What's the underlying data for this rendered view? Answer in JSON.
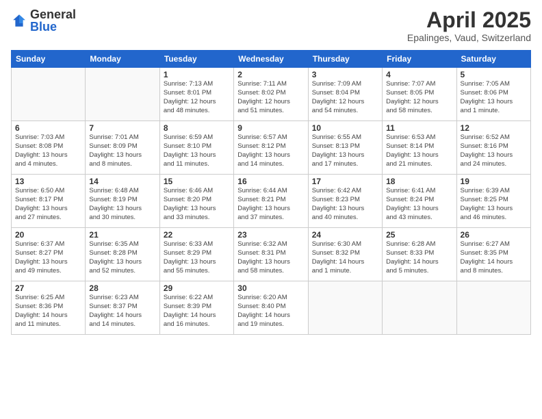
{
  "header": {
    "logo_general": "General",
    "logo_blue": "Blue",
    "month_title": "April 2025",
    "location": "Epalinges, Vaud, Switzerland"
  },
  "days_of_week": [
    "Sunday",
    "Monday",
    "Tuesday",
    "Wednesday",
    "Thursday",
    "Friday",
    "Saturday"
  ],
  "weeks": [
    [
      {
        "day": "",
        "info": ""
      },
      {
        "day": "",
        "info": ""
      },
      {
        "day": "1",
        "info": "Sunrise: 7:13 AM\nSunset: 8:01 PM\nDaylight: 12 hours\nand 48 minutes."
      },
      {
        "day": "2",
        "info": "Sunrise: 7:11 AM\nSunset: 8:02 PM\nDaylight: 12 hours\nand 51 minutes."
      },
      {
        "day": "3",
        "info": "Sunrise: 7:09 AM\nSunset: 8:04 PM\nDaylight: 12 hours\nand 54 minutes."
      },
      {
        "day": "4",
        "info": "Sunrise: 7:07 AM\nSunset: 8:05 PM\nDaylight: 12 hours\nand 58 minutes."
      },
      {
        "day": "5",
        "info": "Sunrise: 7:05 AM\nSunset: 8:06 PM\nDaylight: 13 hours\nand 1 minute."
      }
    ],
    [
      {
        "day": "6",
        "info": "Sunrise: 7:03 AM\nSunset: 8:08 PM\nDaylight: 13 hours\nand 4 minutes."
      },
      {
        "day": "7",
        "info": "Sunrise: 7:01 AM\nSunset: 8:09 PM\nDaylight: 13 hours\nand 8 minutes."
      },
      {
        "day": "8",
        "info": "Sunrise: 6:59 AM\nSunset: 8:10 PM\nDaylight: 13 hours\nand 11 minutes."
      },
      {
        "day": "9",
        "info": "Sunrise: 6:57 AM\nSunset: 8:12 PM\nDaylight: 13 hours\nand 14 minutes."
      },
      {
        "day": "10",
        "info": "Sunrise: 6:55 AM\nSunset: 8:13 PM\nDaylight: 13 hours\nand 17 minutes."
      },
      {
        "day": "11",
        "info": "Sunrise: 6:53 AM\nSunset: 8:14 PM\nDaylight: 13 hours\nand 21 minutes."
      },
      {
        "day": "12",
        "info": "Sunrise: 6:52 AM\nSunset: 8:16 PM\nDaylight: 13 hours\nand 24 minutes."
      }
    ],
    [
      {
        "day": "13",
        "info": "Sunrise: 6:50 AM\nSunset: 8:17 PM\nDaylight: 13 hours\nand 27 minutes."
      },
      {
        "day": "14",
        "info": "Sunrise: 6:48 AM\nSunset: 8:19 PM\nDaylight: 13 hours\nand 30 minutes."
      },
      {
        "day": "15",
        "info": "Sunrise: 6:46 AM\nSunset: 8:20 PM\nDaylight: 13 hours\nand 33 minutes."
      },
      {
        "day": "16",
        "info": "Sunrise: 6:44 AM\nSunset: 8:21 PM\nDaylight: 13 hours\nand 37 minutes."
      },
      {
        "day": "17",
        "info": "Sunrise: 6:42 AM\nSunset: 8:23 PM\nDaylight: 13 hours\nand 40 minutes."
      },
      {
        "day": "18",
        "info": "Sunrise: 6:41 AM\nSunset: 8:24 PM\nDaylight: 13 hours\nand 43 minutes."
      },
      {
        "day": "19",
        "info": "Sunrise: 6:39 AM\nSunset: 8:25 PM\nDaylight: 13 hours\nand 46 minutes."
      }
    ],
    [
      {
        "day": "20",
        "info": "Sunrise: 6:37 AM\nSunset: 8:27 PM\nDaylight: 13 hours\nand 49 minutes."
      },
      {
        "day": "21",
        "info": "Sunrise: 6:35 AM\nSunset: 8:28 PM\nDaylight: 13 hours\nand 52 minutes."
      },
      {
        "day": "22",
        "info": "Sunrise: 6:33 AM\nSunset: 8:29 PM\nDaylight: 13 hours\nand 55 minutes."
      },
      {
        "day": "23",
        "info": "Sunrise: 6:32 AM\nSunset: 8:31 PM\nDaylight: 13 hours\nand 58 minutes."
      },
      {
        "day": "24",
        "info": "Sunrise: 6:30 AM\nSunset: 8:32 PM\nDaylight: 14 hours\nand 1 minute."
      },
      {
        "day": "25",
        "info": "Sunrise: 6:28 AM\nSunset: 8:33 PM\nDaylight: 14 hours\nand 5 minutes."
      },
      {
        "day": "26",
        "info": "Sunrise: 6:27 AM\nSunset: 8:35 PM\nDaylight: 14 hours\nand 8 minutes."
      }
    ],
    [
      {
        "day": "27",
        "info": "Sunrise: 6:25 AM\nSunset: 8:36 PM\nDaylight: 14 hours\nand 11 minutes."
      },
      {
        "day": "28",
        "info": "Sunrise: 6:23 AM\nSunset: 8:37 PM\nDaylight: 14 hours\nand 14 minutes."
      },
      {
        "day": "29",
        "info": "Sunrise: 6:22 AM\nSunset: 8:39 PM\nDaylight: 14 hours\nand 16 minutes."
      },
      {
        "day": "30",
        "info": "Sunrise: 6:20 AM\nSunset: 8:40 PM\nDaylight: 14 hours\nand 19 minutes."
      },
      {
        "day": "",
        "info": ""
      },
      {
        "day": "",
        "info": ""
      },
      {
        "day": "",
        "info": ""
      }
    ]
  ]
}
